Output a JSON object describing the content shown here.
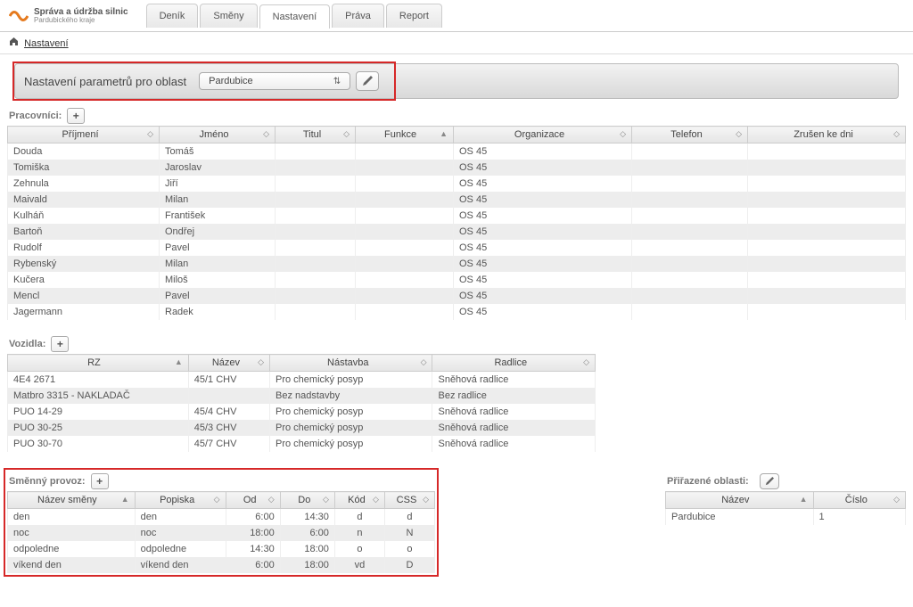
{
  "logo": {
    "line1": "Správa a údržba silnic",
    "line2": "Pardubického kraje"
  },
  "nav": {
    "tabs": [
      {
        "label": "Deník",
        "active": false
      },
      {
        "label": "Směny",
        "active": false
      },
      {
        "label": "Nastavení",
        "active": true
      },
      {
        "label": "Práva",
        "active": false
      },
      {
        "label": "Report",
        "active": false
      }
    ]
  },
  "breadcrumb": {
    "label": "Nastavení"
  },
  "section": {
    "title": "Nastavení parametrů pro oblast",
    "region": "Pardubice"
  },
  "workers": {
    "title": "Pracovníci:",
    "columns": [
      "Příjmení",
      "Jméno",
      "Titul",
      "Funkce",
      "Organizace",
      "Telefon",
      "Zrušen ke dni"
    ],
    "rows": [
      {
        "surname": "Douda",
        "name": "Tomáš",
        "title": "",
        "func": "",
        "org": "OS 45",
        "phone": "",
        "canceled": ""
      },
      {
        "surname": "Tomiška",
        "name": "Jaroslav",
        "title": "",
        "func": "",
        "org": "OS 45",
        "phone": "",
        "canceled": ""
      },
      {
        "surname": "Zehnula",
        "name": "Jiří",
        "title": "",
        "func": "",
        "org": "OS 45",
        "phone": "",
        "canceled": ""
      },
      {
        "surname": "Maivald",
        "name": "Milan",
        "title": "",
        "func": "",
        "org": "OS 45",
        "phone": "",
        "canceled": ""
      },
      {
        "surname": "Kulháň",
        "name": "František",
        "title": "",
        "func": "",
        "org": "OS 45",
        "phone": "",
        "canceled": ""
      },
      {
        "surname": "Bartoň",
        "name": "Ondřej",
        "title": "",
        "func": "",
        "org": "OS 45",
        "phone": "",
        "canceled": ""
      },
      {
        "surname": "Rudolf",
        "name": "Pavel",
        "title": "",
        "func": "",
        "org": "OS 45",
        "phone": "",
        "canceled": ""
      },
      {
        "surname": "Rybenský",
        "name": "Milan",
        "title": "",
        "func": "",
        "org": "OS 45",
        "phone": "",
        "canceled": ""
      },
      {
        "surname": "Kučera",
        "name": "Miloš",
        "title": "",
        "func": "",
        "org": "OS 45",
        "phone": "",
        "canceled": ""
      },
      {
        "surname": "Mencl",
        "name": "Pavel",
        "title": "",
        "func": "",
        "org": "OS 45",
        "phone": "",
        "canceled": ""
      },
      {
        "surname": "Jagermann",
        "name": "Radek",
        "title": "",
        "func": "",
        "org": "OS 45",
        "phone": "",
        "canceled": ""
      }
    ]
  },
  "vehicles": {
    "title": "Vozidla:",
    "columns": [
      "RZ",
      "Název",
      "Nástavba",
      "Radlice"
    ],
    "rows": [
      {
        "rz": "4E4 2671",
        "nazev": "45/1 CHV",
        "nastavba": "Pro chemický posyp",
        "radlice": "Sněhová radlice"
      },
      {
        "rz": "Matbro 3315 - NAKLADAČ",
        "nazev": "",
        "nastavba": "Bez nadstavby",
        "radlice": "Bez radlice"
      },
      {
        "rz": "PUO 14-29",
        "nazev": "45/4 CHV",
        "nastavba": "Pro chemický posyp",
        "radlice": "Sněhová radlice"
      },
      {
        "rz": "PUO 30-25",
        "nazev": "45/3 CHV",
        "nastavba": "Pro chemický posyp",
        "radlice": "Sněhová radlice"
      },
      {
        "rz": "PUO 30-70",
        "nazev": "45/7 CHV",
        "nastavba": "Pro chemický posyp",
        "radlice": "Sněhová radlice"
      }
    ]
  },
  "shifts": {
    "title": "Směnný provoz:",
    "columns": [
      "Název směny",
      "Popiska",
      "Od",
      "Do",
      "Kód",
      "CSS"
    ],
    "rows": [
      {
        "name": "den",
        "pop": "den",
        "od": "6:00",
        "do": "14:30",
        "kod": "d",
        "css": "d"
      },
      {
        "name": "noc",
        "pop": "noc",
        "od": "18:00",
        "do": "6:00",
        "kod": "n",
        "css": "N"
      },
      {
        "name": "odpoledne",
        "pop": "odpoledne",
        "od": "14:30",
        "do": "18:00",
        "kod": "o",
        "css": "o"
      },
      {
        "name": "víkend den",
        "pop": "víkend den",
        "od": "6:00",
        "do": "18:00",
        "kod": "vd",
        "css": "D"
      }
    ]
  },
  "areas": {
    "title": "Přiřazené oblasti:",
    "columns": [
      "Název",
      "Číslo"
    ],
    "rows": [
      {
        "name": "Pardubice",
        "num": "1"
      }
    ]
  }
}
